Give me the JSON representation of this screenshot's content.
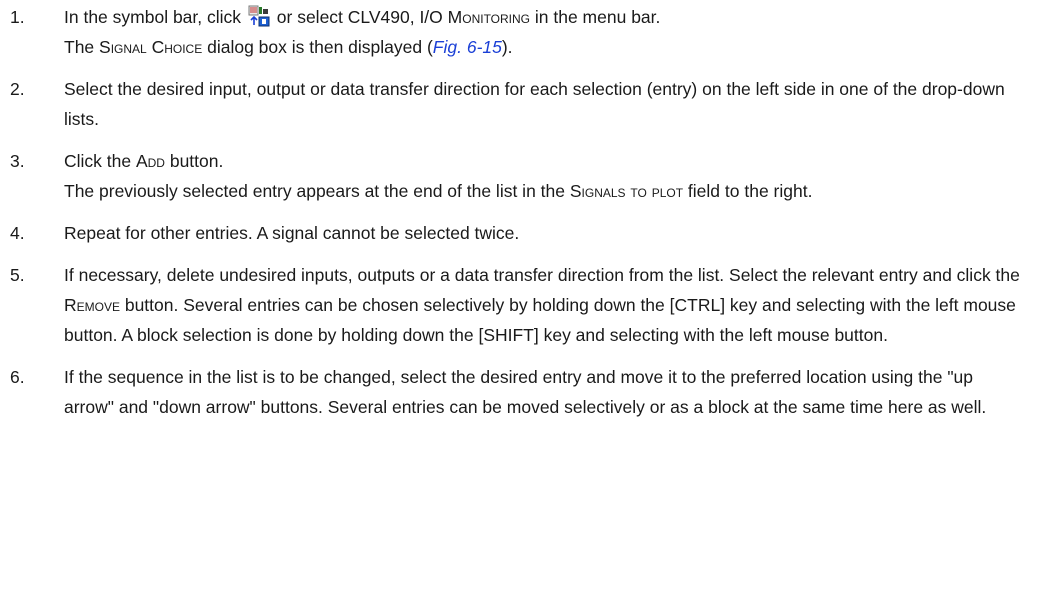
{
  "steps": [
    {
      "num": "1.",
      "line1_pre": "In the symbol bar, click",
      "line1_post": " or select CLV490, I/O ",
      "line1_sc": "Monitoring",
      "line1_tail": " in the menu bar.",
      "line2_pre": "The ",
      "line2_sc": "Signal Choice",
      "line2_mid": " dialog box is then displayed (",
      "line2_link": "Fig. 6-15",
      "line2_tail": ")."
    },
    {
      "num": "2.",
      "text": "Select the desired input, output or data transfer direction for each selection (entry) on the left side in one of the drop-down lists."
    },
    {
      "num": "3.",
      "line1_pre": "Click the ",
      "line1_sc": "Add",
      "line1_tail": " button.",
      "line2_pre": "The previously selected entry appears at the end of the list in the ",
      "line2_sc": "Signals to plot",
      "line2_tail": " field to the right."
    },
    {
      "num": "4.",
      "text": "Repeat for other entries. A signal cannot be selected twice."
    },
    {
      "num": "5.",
      "pre": "If necessary, delete undesired inputs, outputs or a data transfer direction from the list. Select the relevant entry and click the ",
      "sc": "Remove",
      "post": " button. Several entries can be chosen selectively by holding down the [CTRL] key and selecting with the left mouse button. A block selection is done by holding down the [SHIFT] key and selecting with the left mouse button."
    },
    {
      "num": "6.",
      "text": "If the sequence in the list is to be changed, select the desired entry and move it to the preferred location using the \"up arrow\" and \"down arrow\" buttons. Several entries can be moved selectively or as a block at the same time here as well."
    }
  ],
  "icons": {
    "toolbar_icon": "io-monitoring-icon"
  }
}
